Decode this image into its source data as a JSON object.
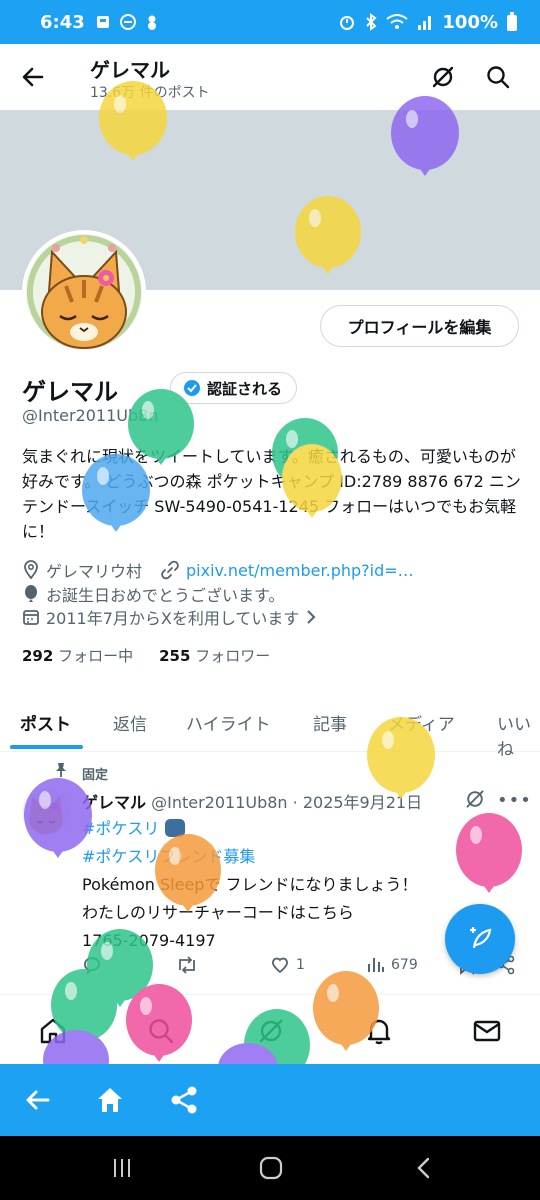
{
  "status_bar": {
    "time": "6:43",
    "battery": "100%"
  },
  "header": {
    "title": "ゲレマル",
    "post_count": "13.6万 件のポスト"
  },
  "profile": {
    "edit_button": "プロフィールを編集",
    "name": "ゲレマル",
    "verify_label": "認証される",
    "handle": "@Inter2011Ub8n",
    "bio": "気まぐれに現状をツイートしています。癒されるもの、可愛いものが好みです。 どうぶつの森 ポケットキャンプ ID:2789 8876 672 ニンテンドースイッチ SW-5490-0541-1245 フォローはいつでもお気軽に！",
    "location": "ゲレマリウ村",
    "website": "pixiv.net/member.php?id=…",
    "birthday": "お誕生日おめでとうございます。",
    "joined": "2011年7月からXを利用しています",
    "following_count": "292",
    "following_label": "フォロー中",
    "followers_count": "255",
    "followers_label": "フォロワー"
  },
  "tabs": [
    {
      "label": "ポスト"
    },
    {
      "label": "返信"
    },
    {
      "label": "ハイライト"
    },
    {
      "label": "記事"
    },
    {
      "label": "メディア"
    },
    {
      "label": "いいね"
    }
  ],
  "post": {
    "pinned_label": "固定",
    "author": "ゲレマル",
    "handle_date": "@Inter2011Ub8n · 2025年9月21日",
    "hashtag1": "#ポケスリ",
    "hashtag2": "#ポケスリフレンド募集",
    "line1": "Pokémon Sleepで フレンドになりましょう！",
    "line2": "わたしのリサーチャーコードはこちら",
    "line3": "1765-2079-4197",
    "likes": "1",
    "views": "679"
  },
  "colors": {
    "accent": "#1d9bf0",
    "browser_bar": "#1da1f2"
  }
}
